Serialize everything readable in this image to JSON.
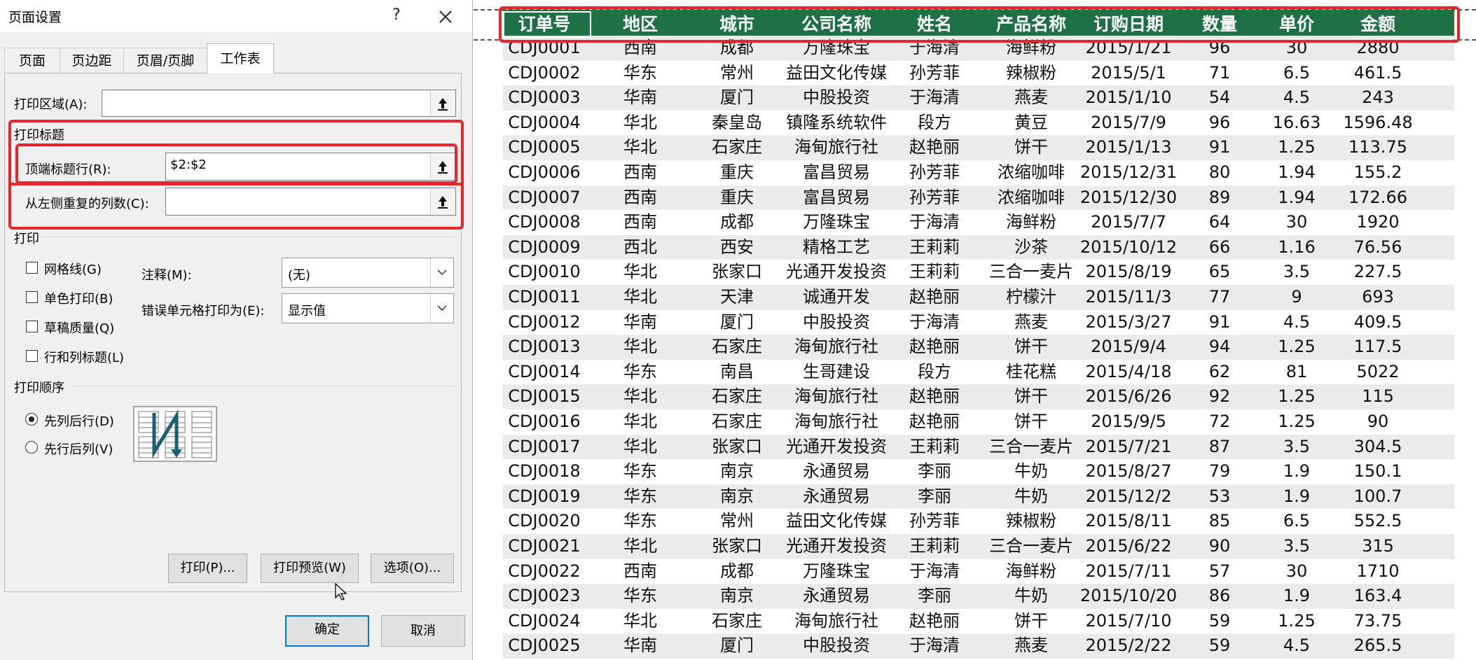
{
  "dialog": {
    "title": "页面设置",
    "help": "?",
    "tabs": [
      "页面",
      "页边距",
      "页眉/页脚",
      "工作表"
    ],
    "print_area_label": "打印区域(A):",
    "print_area_value": "",
    "print_titles_section": "打印标题",
    "top_rows_label": "顶端标题行(R):",
    "top_rows_value": "$2:$2",
    "left_cols_label": "从左侧重复的列数(C):",
    "left_cols_value": "",
    "print_section": "打印",
    "checkboxes": [
      "网格线(G)",
      "单色打印(B)",
      "草稿质量(Q)",
      "行和列标题(L)"
    ],
    "comments_label": "注释(M):",
    "comments_value": "(无)",
    "errors_label": "错误单元格打印为(E):",
    "errors_value": "显示值",
    "order_section": "打印顺序",
    "radios": [
      "先列后行(D)",
      "先行后列(V)"
    ],
    "buttons": {
      "print": "打印(P)...",
      "preview": "打印预览(W)",
      "options": "选项(O)...",
      "ok": "确定",
      "cancel": "取消"
    }
  },
  "sheet": {
    "headers": [
      "订单号",
      "地区",
      "城市",
      "公司名称",
      "姓名",
      "产品名称",
      "订购日期",
      "数量",
      "单价",
      "金额"
    ],
    "rows": [
      [
        "CDJ0001",
        "西南",
        "成都",
        "万隆珠宝",
        "于海清",
        "海鲜粉",
        "2015/1/21",
        "96",
        "30",
        "2880"
      ],
      [
        "CDJ0002",
        "华东",
        "常州",
        "益田文化传媒",
        "孙芳菲",
        "辣椒粉",
        "2015/5/1",
        "71",
        "6.5",
        "461.5"
      ],
      [
        "CDJ0003",
        "华南",
        "厦门",
        "中股投资",
        "于海清",
        "燕麦",
        "2015/1/10",
        "54",
        "4.5",
        "243"
      ],
      [
        "CDJ0004",
        "华北",
        "秦皇岛",
        "镇隆系统软件",
        "段方",
        "黄豆",
        "2015/7/9",
        "96",
        "16.63",
        "1596.48"
      ],
      [
        "CDJ0005",
        "华北",
        "石家庄",
        "海甸旅行社",
        "赵艳丽",
        "饼干",
        "2015/1/13",
        "91",
        "1.25",
        "113.75"
      ],
      [
        "CDJ0006",
        "西南",
        "重庆",
        "富昌贸易",
        "孙芳菲",
        "浓缩咖啡",
        "2015/12/31",
        "80",
        "1.94",
        "155.2"
      ],
      [
        "CDJ0007",
        "西南",
        "重庆",
        "富昌贸易",
        "孙芳菲",
        "浓缩咖啡",
        "2015/12/30",
        "89",
        "1.94",
        "172.66"
      ],
      [
        "CDJ0008",
        "西南",
        "成都",
        "万隆珠宝",
        "于海清",
        "海鲜粉",
        "2015/7/7",
        "64",
        "30",
        "1920"
      ],
      [
        "CDJ0009",
        "西北",
        "西安",
        "精格工艺",
        "王莉莉",
        "沙茶",
        "2015/10/12",
        "66",
        "1.16",
        "76.56"
      ],
      [
        "CDJ0010",
        "华北",
        "张家口",
        "光通开发投资",
        "王莉莉",
        "三合一麦片",
        "2015/8/19",
        "65",
        "3.5",
        "227.5"
      ],
      [
        "CDJ0011",
        "华北",
        "天津",
        "诚通开发",
        "赵艳丽",
        "柠檬汁",
        "2015/11/3",
        "77",
        "9",
        "693"
      ],
      [
        "CDJ0012",
        "华南",
        "厦门",
        "中股投资",
        "于海清",
        "燕麦",
        "2015/3/27",
        "91",
        "4.5",
        "409.5"
      ],
      [
        "CDJ0013",
        "华北",
        "石家庄",
        "海甸旅行社",
        "赵艳丽",
        "饼干",
        "2015/9/4",
        "94",
        "1.25",
        "117.5"
      ],
      [
        "CDJ0014",
        "华东",
        "南昌",
        "生哥建设",
        "段方",
        "桂花糕",
        "2015/4/18",
        "62",
        "81",
        "5022"
      ],
      [
        "CDJ0015",
        "华北",
        "石家庄",
        "海甸旅行社",
        "赵艳丽",
        "饼干",
        "2015/6/26",
        "92",
        "1.25",
        "115"
      ],
      [
        "CDJ0016",
        "华北",
        "石家庄",
        "海甸旅行社",
        "赵艳丽",
        "饼干",
        "2015/9/5",
        "72",
        "1.25",
        "90"
      ],
      [
        "CDJ0017",
        "华北",
        "张家口",
        "光通开发投资",
        "王莉莉",
        "三合一麦片",
        "2015/7/21",
        "87",
        "3.5",
        "304.5"
      ],
      [
        "CDJ0018",
        "华东",
        "南京",
        "永通贸易",
        "李丽",
        "牛奶",
        "2015/8/27",
        "79",
        "1.9",
        "150.1"
      ],
      [
        "CDJ0019",
        "华东",
        "南京",
        "永通贸易",
        "李丽",
        "牛奶",
        "2015/12/2",
        "53",
        "1.9",
        "100.7"
      ],
      [
        "CDJ0020",
        "华东",
        "常州",
        "益田文化传媒",
        "孙芳菲",
        "辣椒粉",
        "2015/8/11",
        "85",
        "6.5",
        "552.5"
      ],
      [
        "CDJ0021",
        "华北",
        "张家口",
        "光通开发投资",
        "王莉莉",
        "三合一麦片",
        "2015/6/22",
        "90",
        "3.5",
        "315"
      ],
      [
        "CDJ0022",
        "西南",
        "成都",
        "万隆珠宝",
        "于海清",
        "海鲜粉",
        "2015/7/11",
        "57",
        "30",
        "1710"
      ],
      [
        "CDJ0023",
        "华东",
        "南京",
        "永通贸易",
        "李丽",
        "牛奶",
        "2015/10/20",
        "86",
        "1.9",
        "163.4"
      ],
      [
        "CDJ0024",
        "华北",
        "石家庄",
        "海甸旅行社",
        "赵艳丽",
        "饼干",
        "2015/7/10",
        "59",
        "1.25",
        "73.75"
      ],
      [
        "CDJ0025",
        "华南",
        "厦门",
        "中股投资",
        "于海清",
        "燕麦",
        "2015/2/22",
        "59",
        "4.5",
        "265.5"
      ]
    ]
  }
}
